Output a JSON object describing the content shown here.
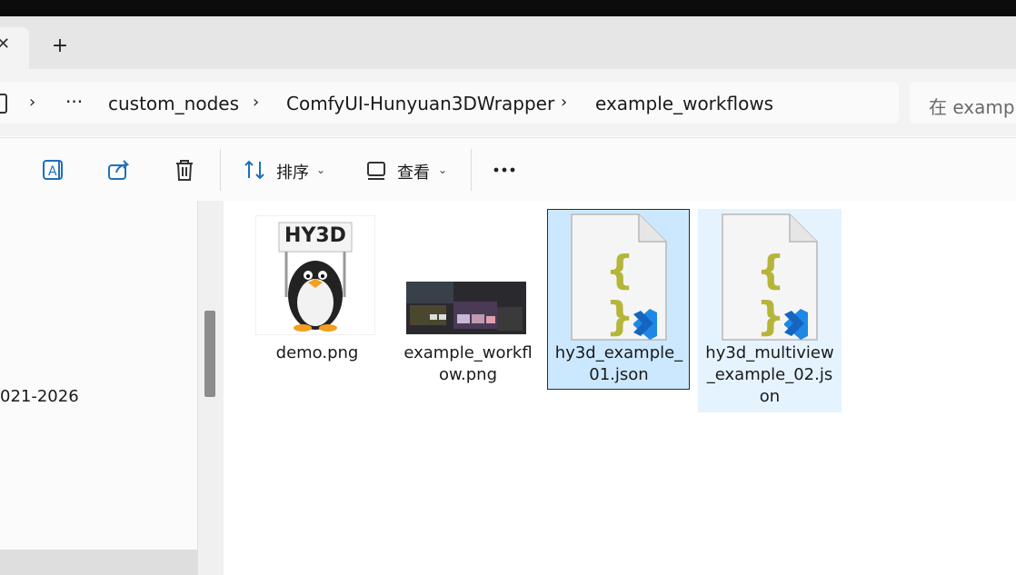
{
  "tabs": {
    "close_glyph": "✕",
    "new_tab_glyph": "+"
  },
  "address": {
    "overflow_label": "···",
    "crumbs": [
      "custom_nodes",
      "ComfyUI-Hunyuan3DWrapper",
      "example_workflows"
    ],
    "search_placeholder": "在 example"
  },
  "toolbar": {
    "sort_label": "排序",
    "view_label": "查看",
    "icons": [
      "rename-icon",
      "share-icon",
      "delete-icon",
      "sort-icon",
      "view-icon",
      "more-icon"
    ]
  },
  "nav": {
    "partial_text": "021-2026"
  },
  "files": [
    {
      "name": "demo.png",
      "image_text": "HY3D",
      "type": "image"
    },
    {
      "name": "example_workflow.png",
      "type": "image"
    },
    {
      "name": "hy3d_example_01.json",
      "type": "json",
      "glyph": "{ }",
      "state": "selected-focused"
    },
    {
      "name": "hy3d_multiview_example_02.json",
      "type": "json",
      "glyph": "{ }",
      "state": "selected"
    }
  ],
  "colors": {
    "json_braces": "#b5b53a",
    "vscode_badge": "#1e88e5",
    "selection": "#cce8ff"
  }
}
